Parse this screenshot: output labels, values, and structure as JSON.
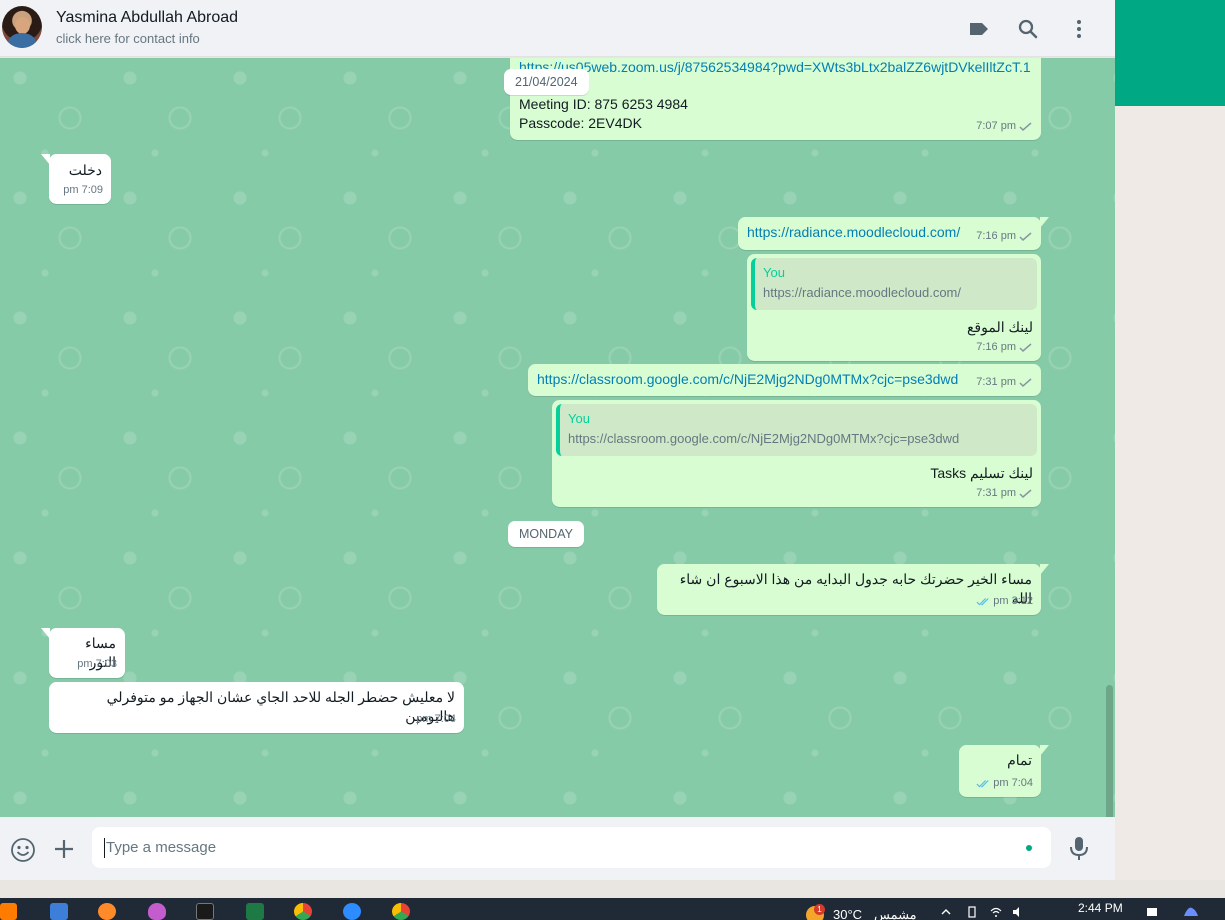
{
  "contact": {
    "name": "Yasmina Abdullah Abroad",
    "subtitle": "click here for contact info"
  },
  "messages": {
    "zoom": {
      "link": "https://us05web.zoom.us/j/87562534984?pwd=XWts3bLtx2balZZ6wjtDVkelIltZcT.1",
      "meeting_id": "Meeting ID: 875 6253 4984",
      "passcode": "Passcode: 2EV4DK",
      "time": "7:07 pm"
    },
    "dakhalt": {
      "text": "دخلت",
      "time": "7:09 pm"
    },
    "moodle_link": {
      "text": "https://radiance.moodlecloud.com/",
      "time": "7:16 pm"
    },
    "moodle_reply": {
      "quote_author": "You",
      "quote_text": "https://radiance.moodlecloud.com/",
      "text": "لينك الموقع",
      "time": "7:16 pm"
    },
    "classroom_link": {
      "text": "https://classroom.google.com/c/NjE2Mjg2NDg0MTMx?cjc=pse3dwd",
      "time": "7:31 pm"
    },
    "classroom_reply": {
      "quote_author": "You",
      "quote_text": "https://classroom.google.com/c/NjE2Mjg2NDg0MTMx?cjc=pse3dwd",
      "text": "لينك تسليم Tasks",
      "time": "7:31 pm"
    },
    "good_evening": {
      "text": "مساء الخير حضرتك حابه جدول البدايه من هذا الاسبوع ان شاء الله",
      "time": "3:12 pm"
    },
    "masa_alnoor": {
      "text": "مساء النور",
      "time": "7:03 pm"
    },
    "la_maalish": {
      "text": "لا معليش حضطر الجله للاحد الجاي عشان الجهاز مو متوفرلي هاليومين",
      "time": "7:04 pm"
    },
    "tamam": {
      "text": "تمام",
      "time": "7:04 pm"
    }
  },
  "date_chips": {
    "sticky": "21/04/2024",
    "monday": "MONDAY"
  },
  "composer": {
    "placeholder": "Type a message"
  },
  "taskbar": {
    "temperature": "30°C",
    "condition": "مشمس",
    "time": "2:44 PM",
    "weather_badge": "1"
  },
  "colors": {
    "chat_background": "#86cba7",
    "outgoing_bubble": "#d9fdd3",
    "incoming_bubble": "#ffffff",
    "accent": "#00a884",
    "link": "#027eb5",
    "read_tick": "#53bdeb"
  },
  "icons": [
    "label-icon",
    "search-icon",
    "menu-icon",
    "emoji-icon",
    "plus-icon",
    "mic-icon"
  ]
}
